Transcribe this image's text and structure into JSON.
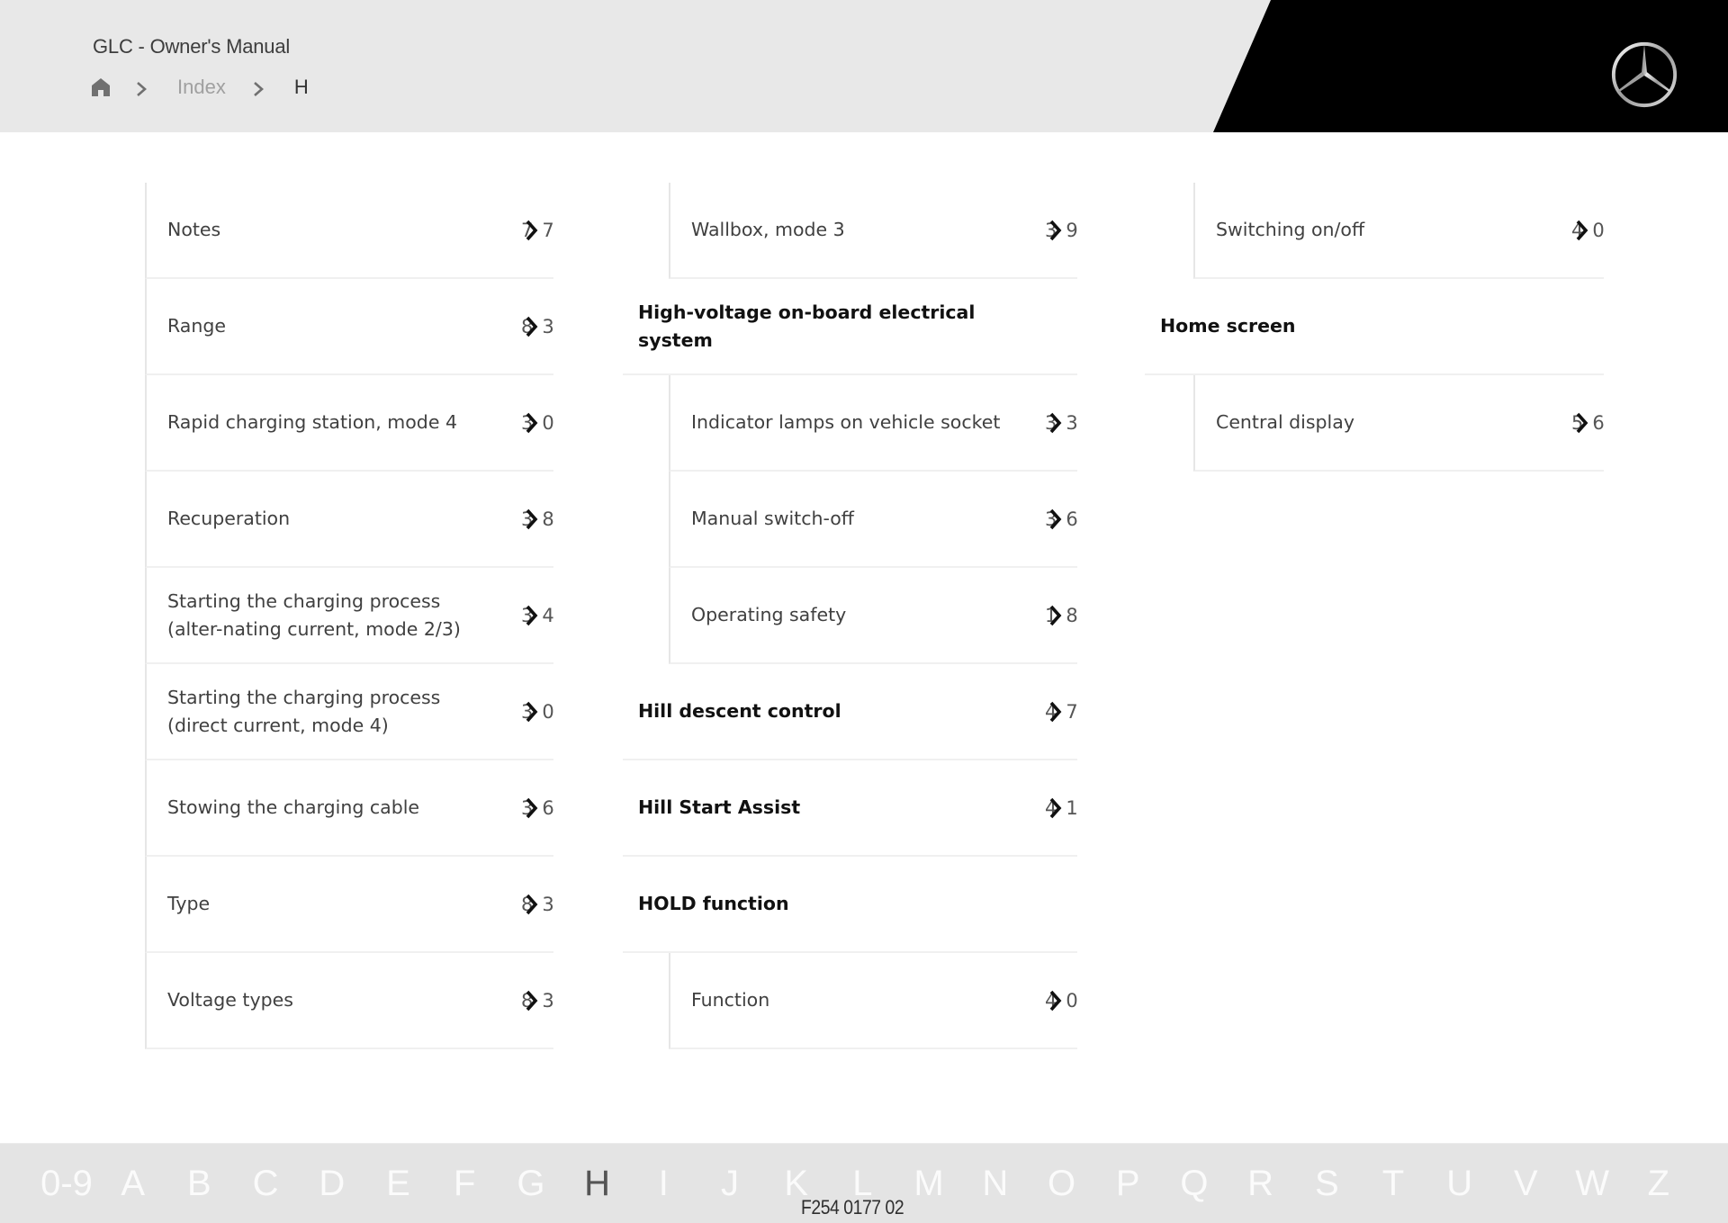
{
  "header": {
    "title": "GLC - Owner's Manual",
    "breadcrumb": {
      "home_icon": "home-icon",
      "separator_icon": "chevron-right-icon",
      "items": [
        "Index",
        "H"
      ]
    },
    "logo": "mercedes-benz-star-logo"
  },
  "colors": {
    "header_bg": "#e8e8e8",
    "header_accent": "#000000",
    "footer_bg": "#e4e4e4",
    "active_letter": "#555555"
  },
  "index": {
    "columns": [
      {
        "rows": [
          {
            "type": "sub",
            "label": "Notes",
            "page": {
              "pre": "7",
              "post": "7"
            }
          },
          {
            "type": "sub",
            "label": "Range",
            "page": {
              "pre": "8",
              "post": "3"
            }
          },
          {
            "type": "sub",
            "label": "Rapid charging station, mode 4",
            "page": {
              "pre": "3",
              "post": "0"
            }
          },
          {
            "type": "sub",
            "label": "Recuperation",
            "page": {
              "pre": "3",
              "post": "8"
            }
          },
          {
            "type": "sub",
            "label": "Starting the charging process (alter-nating current, mode 2/3)",
            "page": {
              "pre": "3",
              "post": "4"
            }
          },
          {
            "type": "sub",
            "label": "Starting the charging process (direct current, mode 4)",
            "page": {
              "pre": "3",
              "post": "0"
            }
          },
          {
            "type": "sub",
            "label": "Stowing the charging cable",
            "page": {
              "pre": "3",
              "post": "6"
            }
          },
          {
            "type": "sub",
            "label": "Type",
            "page": {
              "pre": "8",
              "post": "3"
            }
          },
          {
            "type": "sub",
            "label": "Voltage types",
            "page": {
              "pre": "8",
              "post": "3"
            }
          }
        ]
      },
      {
        "rows": [
          {
            "type": "sub",
            "label": "Wallbox, mode 3",
            "page": {
              "pre": "3",
              "post": "9"
            }
          },
          {
            "type": "head",
            "label": "High-voltage on-board electrical system",
            "page": null
          },
          {
            "type": "sub",
            "label": "Indicator lamps on vehicle socket",
            "page": {
              "pre": "3",
              "post": "3"
            }
          },
          {
            "type": "sub",
            "label": "Manual switch-off",
            "page": {
              "pre": "3",
              "post": "6"
            }
          },
          {
            "type": "sub",
            "label": "Operating safety",
            "page": {
              "pre": "1",
              "post": "8"
            }
          },
          {
            "type": "head",
            "label": "Hill descent control",
            "page": {
              "pre": "4",
              "post": "7"
            }
          },
          {
            "type": "head",
            "label": "Hill Start Assist",
            "page": {
              "pre": "4",
              "post": "1"
            }
          },
          {
            "type": "head",
            "label": "HOLD function",
            "page": null
          },
          {
            "type": "sub",
            "label": "Function",
            "page": {
              "pre": "4",
              "post": "0"
            }
          }
        ]
      },
      {
        "rows": [
          {
            "type": "sub",
            "label": "Switching on/off",
            "page": {
              "pre": "4",
              "post": "0"
            }
          },
          {
            "type": "head",
            "label": "Home screen",
            "page": null
          },
          {
            "type": "sub",
            "label": "Central display",
            "page": {
              "pre": "5",
              "post": "6"
            }
          }
        ]
      }
    ],
    "page_link_icon": "chevron-right-icon"
  },
  "footer": {
    "letters": [
      "0-9",
      "A",
      "B",
      "C",
      "D",
      "E",
      "F",
      "G",
      "H",
      "I",
      "J",
      "K",
      "L",
      "M",
      "N",
      "O",
      "P",
      "Q",
      "R",
      "S",
      "T",
      "U",
      "V",
      "W",
      "Z"
    ],
    "active_letter": "H",
    "document_code": "F254 0177 02"
  }
}
